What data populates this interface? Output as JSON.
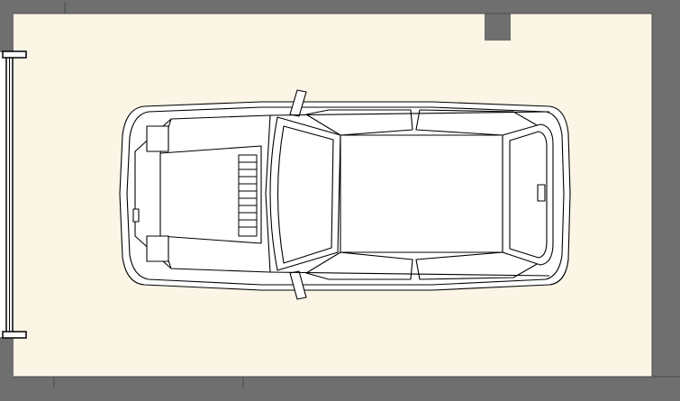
{
  "plan": {
    "type": "garage-floor-plan",
    "floor_color": "#fbf5e6",
    "wall_color": "#6f6f6f",
    "line_color": "#000000",
    "car_fill": "#ffffff",
    "door": "overhead-door-left",
    "vehicle": "car-top-view"
  }
}
